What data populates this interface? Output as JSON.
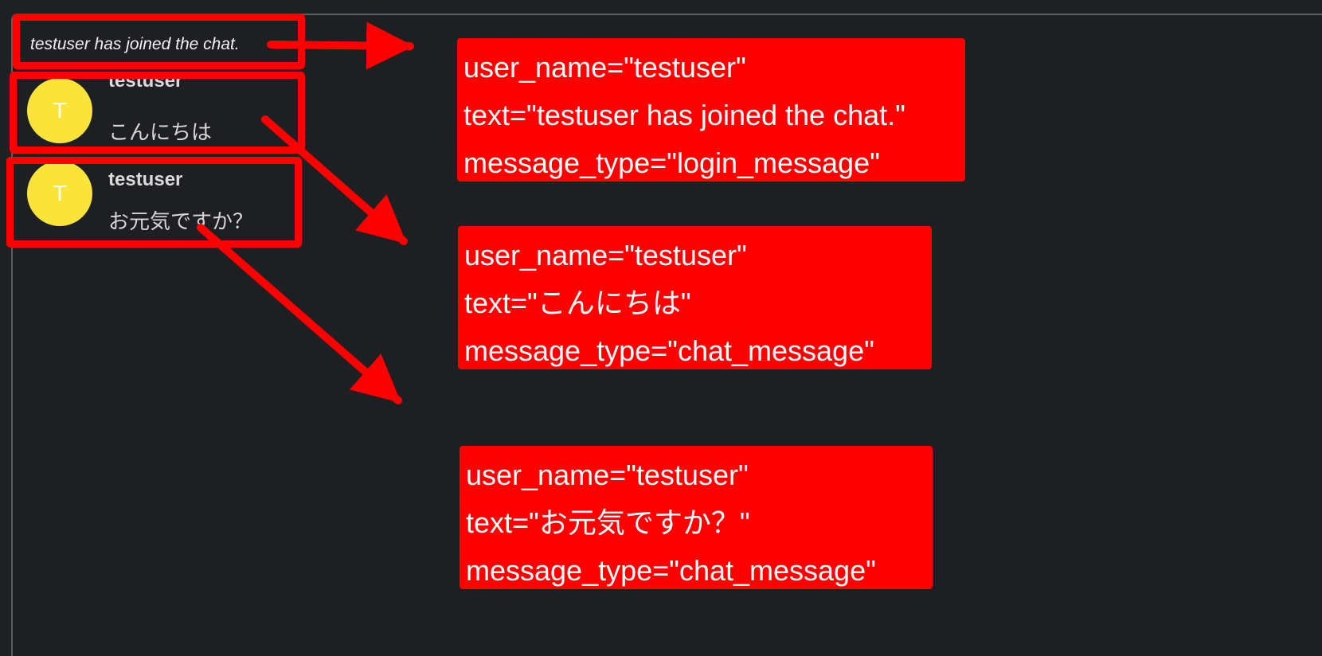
{
  "chat": {
    "login_message": "testuser has joined the chat.",
    "messages": [
      {
        "avatar_initial": "T",
        "user_name": "testuser",
        "text": "こんにちは"
      },
      {
        "avatar_initial": "T",
        "user_name": "testuser",
        "text": "お元気ですか？"
      }
    ]
  },
  "annotations": [
    {
      "user_name": "user_name=\"testuser\"",
      "text": "text=\"testuser has joined the chat.\"",
      "message_type": "message_type=\"login_message\""
    },
    {
      "user_name": "user_name=\"testuser\"",
      "text": "text=\"こんにちは\"",
      "message_type": "message_type=\"chat_message\""
    },
    {
      "user_name": "user_name=\"testuser\"",
      "text": "text=\"お元気ですか？\"",
      "message_type": "message_type=\"chat_message\""
    }
  ],
  "colors": {
    "background": "#1f2023",
    "avatar": "#fbe43a",
    "annotation_red": "#ff0000"
  }
}
